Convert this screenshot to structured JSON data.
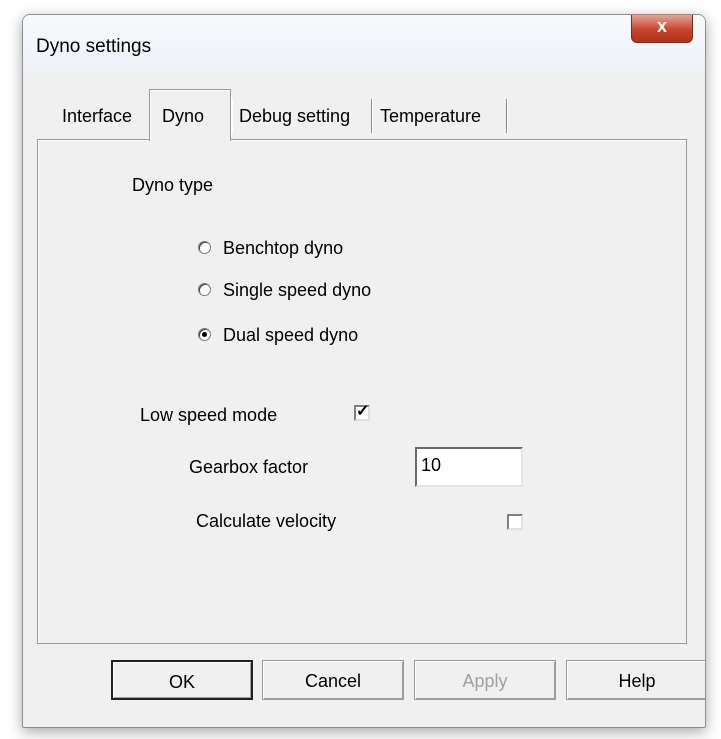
{
  "window": {
    "title": "Dyno settings",
    "close_glyph": "x"
  },
  "tabs": [
    {
      "label": "Interface"
    },
    {
      "label": "Dyno"
    },
    {
      "label": "Debug setting"
    },
    {
      "label": "Temperature"
    }
  ],
  "dyno": {
    "type_label": "Dyno type",
    "options": [
      {
        "label": "Benchtop dyno",
        "selected": false
      },
      {
        "label": "Single speed dyno",
        "selected": false
      },
      {
        "label": "Dual speed dyno",
        "selected": true
      }
    ],
    "low_speed_mode": {
      "label": "Low speed mode",
      "checked": true,
      "check_glyph": "✓"
    },
    "gearbox_factor": {
      "label": "Gearbox factor",
      "value": "10"
    },
    "calculate_velocity": {
      "label": "Calculate velocity",
      "checked": false
    }
  },
  "buttons": {
    "ok": "OK",
    "cancel": "Cancel",
    "apply": "Apply",
    "help": "Help"
  }
}
